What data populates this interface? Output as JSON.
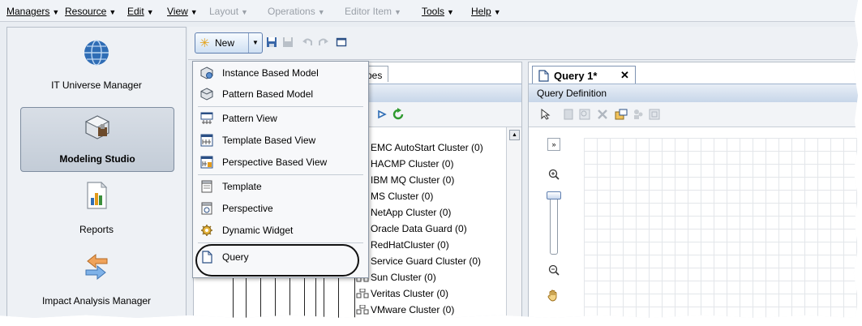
{
  "menubar": {
    "items": [
      {
        "label": "Managers",
        "disabled": false
      },
      {
        "label": "Resource",
        "disabled": false
      },
      {
        "label": "Edit",
        "disabled": false
      },
      {
        "label": "View",
        "disabled": false
      },
      {
        "label": "Layout",
        "disabled": true
      },
      {
        "label": "Operations",
        "disabled": true
      },
      {
        "label": "Editor Item",
        "disabled": true
      },
      {
        "label": "Tools",
        "disabled": false
      },
      {
        "label": "Help",
        "disabled": false
      }
    ]
  },
  "left_nav": {
    "items": [
      {
        "label": "IT Universe Manager",
        "icon": "globe-icon",
        "selected": false
      },
      {
        "label": "Modeling Studio",
        "icon": "modeling-studio-icon",
        "selected": true
      },
      {
        "label": "Reports",
        "icon": "reports-icon",
        "selected": false
      },
      {
        "label": "Impact Analysis Manager",
        "icon": "impact-analysis-icon",
        "selected": false
      }
    ]
  },
  "toolbar": {
    "new_label": "New"
  },
  "new_menu": {
    "items": [
      {
        "label": "Instance Based Model",
        "icon": "instance-model-icon"
      },
      {
        "label": "Pattern Based Model",
        "icon": "pattern-model-icon"
      },
      {
        "label": "Pattern View",
        "icon": "pattern-view-icon"
      },
      {
        "label": "Template Based View",
        "icon": "template-view-icon"
      },
      {
        "label": "Perspective Based View",
        "icon": "perspective-view-icon"
      },
      {
        "label": "Template",
        "icon": "template-icon"
      },
      {
        "label": "Perspective",
        "icon": "perspective-icon"
      },
      {
        "label": "Dynamic Widget",
        "icon": "dynamic-widget-icon"
      },
      {
        "label": "Query",
        "icon": "query-icon"
      }
    ]
  },
  "center_panel": {
    "tab_label": "pes",
    "tree_items": [
      "EMC AutoStart Cluster (0)",
      "HACMP Cluster (0)",
      "IBM MQ Cluster (0)",
      "MS Cluster (0)",
      "NetApp Cluster (0)",
      "Oracle Data Guard (0)",
      "RedHatCluster (0)",
      "Service Guard Cluster (0)",
      "Sun Cluster (0)",
      "Veritas Cluster (0)",
      "VMware Cluster (0)"
    ]
  },
  "right_panel": {
    "tab_label": "Query 1*",
    "close_label": "✕",
    "section_title": "Query Definition"
  }
}
